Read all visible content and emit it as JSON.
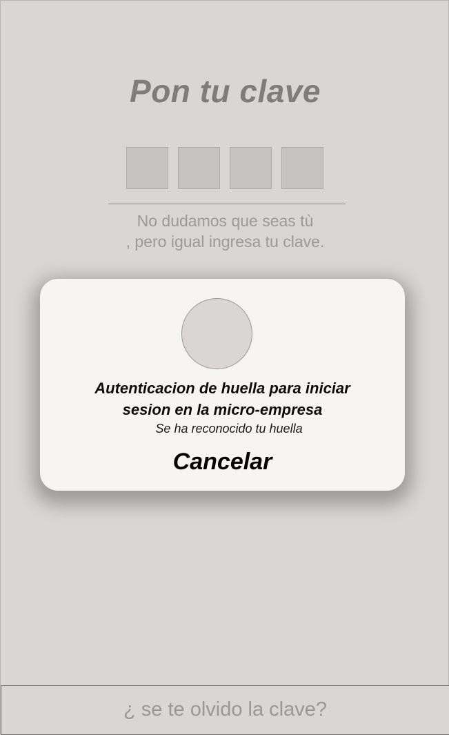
{
  "screen": {
    "title": "Pon tu clave",
    "pin_digits": [
      "",
      "",
      "",
      ""
    ],
    "hint_line_1": "No dudamos que seas tù",
    "hint_line_2": ", pero igual ingresa tu clave."
  },
  "dialog": {
    "icon": "fingerprint-icon",
    "title_line_1": "Autenticacion de huella para iniciar",
    "title_line_2": "sesion en la micro-empresa",
    "status": "Se ha reconocido tu huella",
    "cancel_label": "Cancelar"
  },
  "footer": {
    "forgot_label": "¿ se te olvido la clave?"
  }
}
